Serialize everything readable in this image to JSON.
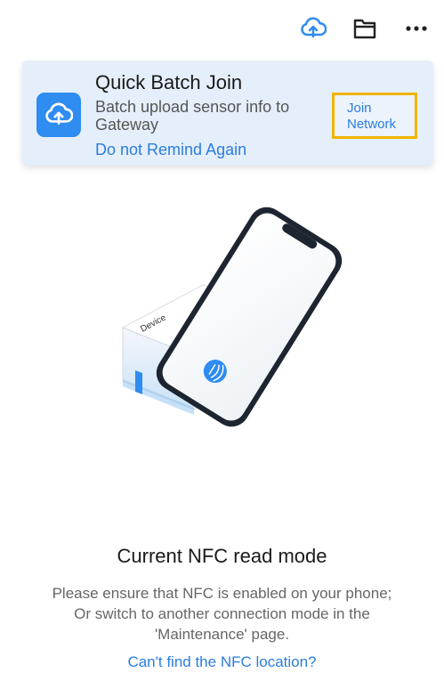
{
  "topbar": {
    "icons": [
      "cloud-upload-icon",
      "folder-icon",
      "more-icon"
    ]
  },
  "banner": {
    "icon": "cloud-upload-icon",
    "title": "Quick Batch Join",
    "description_line1": "Batch upload sensor info to",
    "description_line2": "Gateway",
    "dismiss_label": "Do not Remind Again",
    "join_label_line1": "Join",
    "join_label_line2": "Network",
    "accent_color": "#2f8cf0",
    "highlight_color": "#f0b400"
  },
  "illustration": {
    "device_label": "Device",
    "phone_badge_icon": "nfc-icon"
  },
  "nfc": {
    "title": "Current NFC read mode",
    "desc_line1": "Please ensure that NFC is enabled on your phone;",
    "desc_line2": "Or switch to another connection mode in the",
    "desc_line3": "'Maintenance' page.",
    "help_link": "Can't find the NFC location?"
  }
}
